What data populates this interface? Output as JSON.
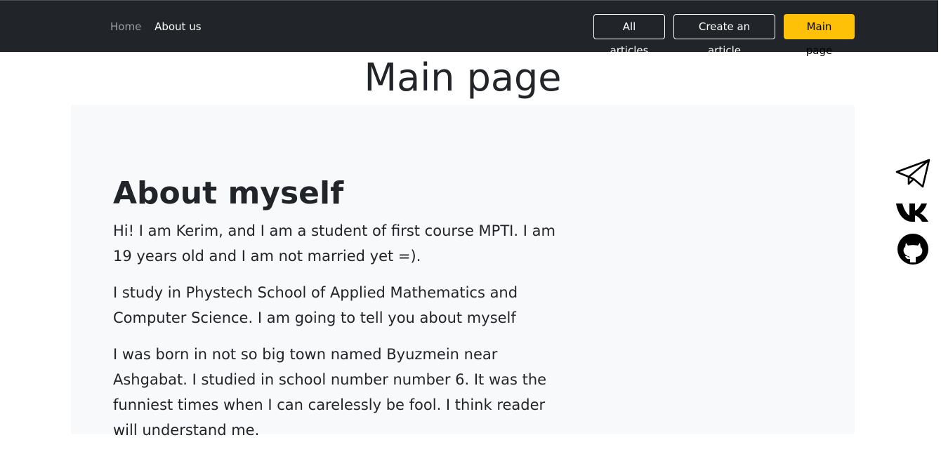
{
  "nav": {
    "home_label": "Home",
    "about_label": "About us",
    "all_articles_label": "All articles",
    "create_article_label": "Create an article",
    "main_page_label": "Main page"
  },
  "page": {
    "title": "Main page"
  },
  "about": {
    "heading": "About myself",
    "paragraphs": [
      "Hi! I am Kerim, and I am a student of first course MPTI. I am 19 years old and I am not married yet =).",
      "I study in Phystech School of Applied Mathematics and Computer Science. I am going to tell you about myself",
      "I was born in not so big town named Byuzmein near Ashgabat. I studied in school number number 6. It was the funniest times when I can carelessly be fool. I think reader will understand me."
    ]
  },
  "socials": {
    "telegram_icon": "telegram-icon",
    "vk_icon": "vk-icon",
    "github_icon": "github-icon"
  },
  "colors": {
    "navbar_bg": "#212529",
    "accent": "#ffc107",
    "card_bg": "#f8f9fa",
    "text": "#212529"
  }
}
